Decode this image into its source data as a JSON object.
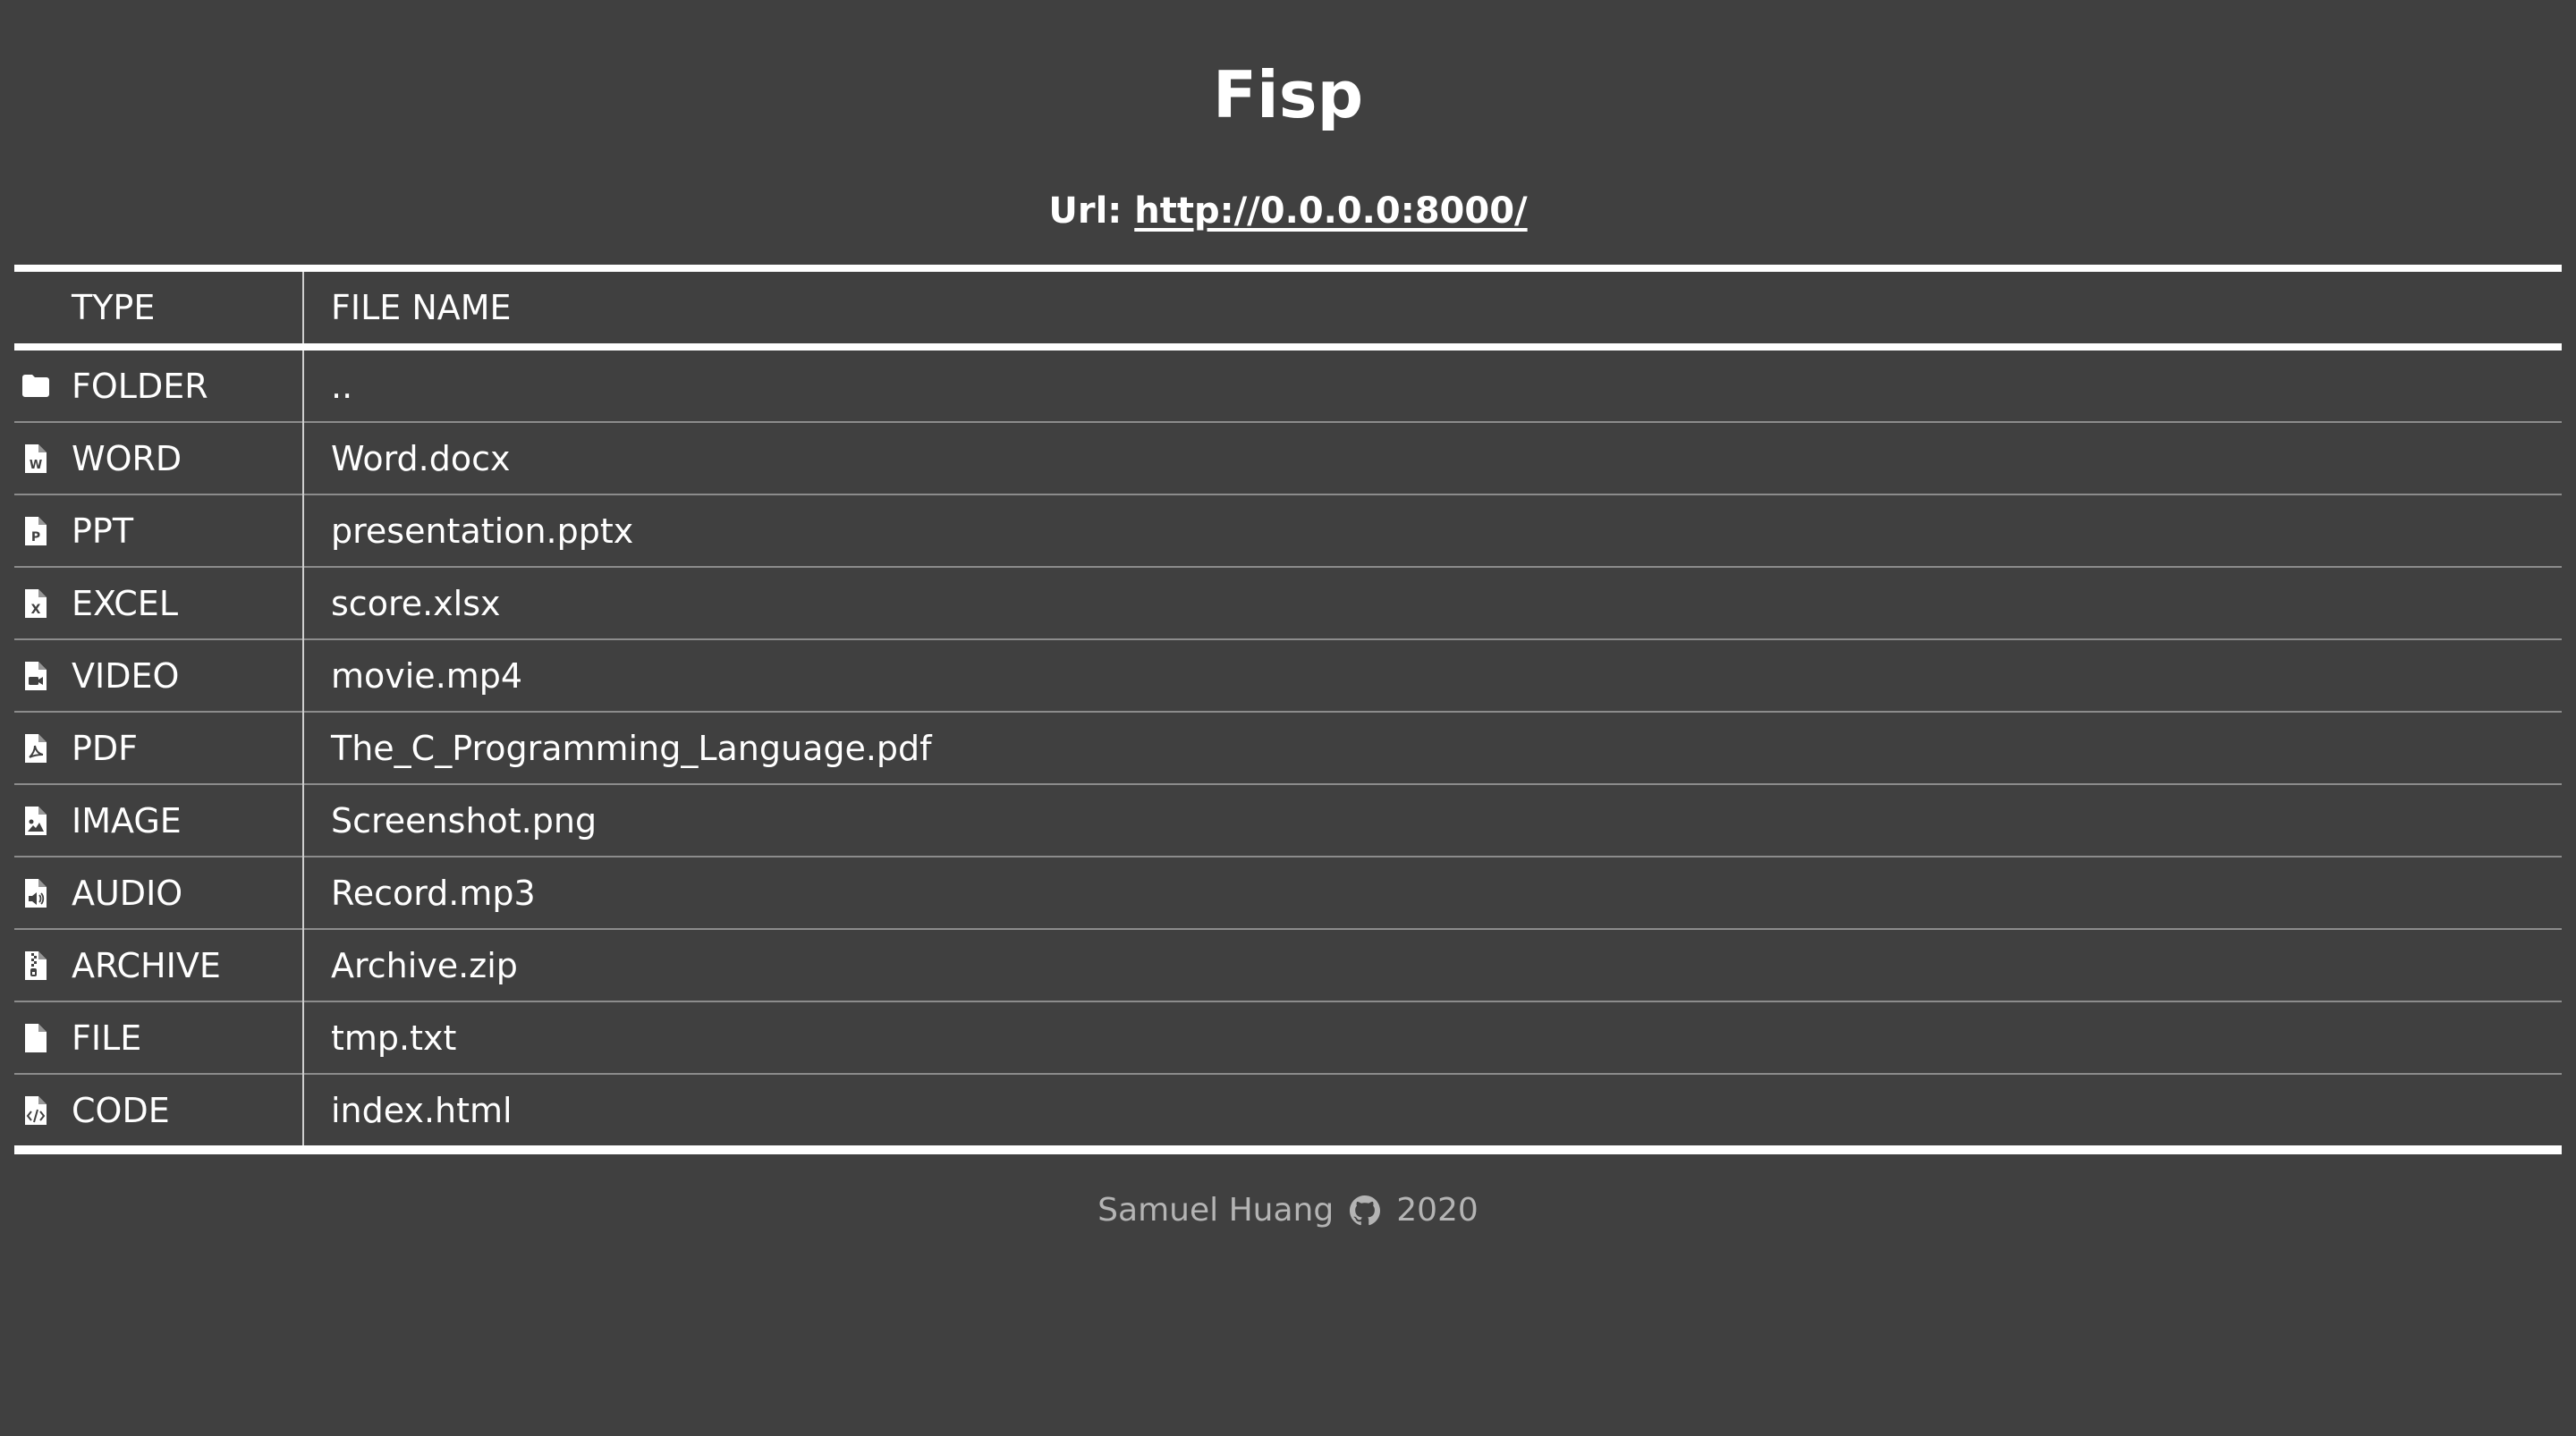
{
  "page": {
    "title": "Fisp",
    "url_label": "Url:",
    "url": "http://0.0.0.0:8000/"
  },
  "table": {
    "headers": {
      "type": "TYPE",
      "name": "FILE NAME"
    },
    "rows": [
      {
        "type": "FOLDER",
        "name": "..",
        "icon": "folder-icon"
      },
      {
        "type": "WORD",
        "name": "Word.docx",
        "icon": "word-file-icon"
      },
      {
        "type": "PPT",
        "name": "presentation.pptx",
        "icon": "powerpoint-file-icon"
      },
      {
        "type": "EXCEL",
        "name": "score.xlsx",
        "icon": "excel-file-icon"
      },
      {
        "type": "VIDEO",
        "name": "movie.mp4",
        "icon": "video-file-icon"
      },
      {
        "type": "PDF",
        "name": "The_C_Programming_Language.pdf",
        "icon": "pdf-file-icon"
      },
      {
        "type": "IMAGE",
        "name": "Screenshot.png",
        "icon": "image-file-icon"
      },
      {
        "type": "AUDIO",
        "name": "Record.mp3",
        "icon": "audio-file-icon"
      },
      {
        "type": "ARCHIVE",
        "name": "Archive.zip",
        "icon": "archive-file-icon"
      },
      {
        "type": "FILE",
        "name": "tmp.txt",
        "icon": "file-icon"
      },
      {
        "type": "CODE",
        "name": "index.html",
        "icon": "code-file-icon"
      }
    ]
  },
  "footer": {
    "author": "Samuel Huang",
    "icon": "github-icon",
    "year": "2020"
  },
  "colors": {
    "background": "#404040",
    "text": "#ffffff",
    "footer_text": "#b4b4b4",
    "row_divider": "#8c8c8c"
  }
}
